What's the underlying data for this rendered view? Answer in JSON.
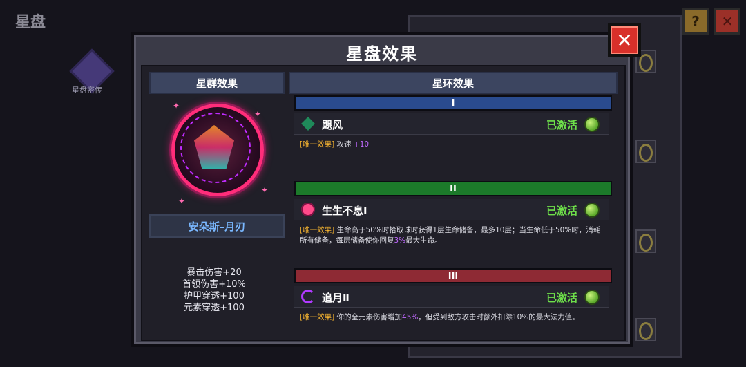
{
  "background": {
    "title": "星盘",
    "side_label": "星盘密传"
  },
  "modal": {
    "title": "星盘效果",
    "close_symbol": "✕"
  },
  "constellation": {
    "header": "星群效果",
    "name": "安朵斯–月刃",
    "stats": [
      "暴击伤害+20",
      "首领伤害+10%",
      "护甲穿透+100",
      "元素穿透+100"
    ]
  },
  "rings": {
    "header": "星环效果",
    "tiers": [
      {
        "numeral": "I",
        "skill_name": "飓风",
        "status": "已激活",
        "icon": "wind-icon",
        "desc_tag": "[唯一效果]",
        "desc_pre": "攻速",
        "desc_hl": "+10",
        "desc_post": ""
      },
      {
        "numeral": "II",
        "skill_name": "生生不息Ⅰ",
        "status": "已激活",
        "icon": "flower-icon",
        "desc_tag": "[唯一效果]",
        "desc_pre": "生命高于50%时拾取球时获得1层生命储备，最多10层；当生命低于50%时，消耗所有储备，每层储备使你回复",
        "desc_hl": "3%",
        "desc_post": "最大生命。"
      },
      {
        "numeral": "III",
        "skill_name": "追月Ⅱ",
        "status": "已激活",
        "icon": "moon-icon",
        "desc_tag": "[唯一效果]",
        "desc_pre": "你的全元素伤害增加",
        "desc_hl": "45%",
        "desc_post": "，但受到敌方攻击时额外扣除10%的最大法力值。"
      }
    ]
  },
  "colors": {
    "active": "#6ee04a",
    "tag": "#f0b030",
    "highlight": "#c06aff",
    "tier1": "#2a4b8e",
    "tier2": "#1c7a2a",
    "tier3": "#8e2a34"
  }
}
